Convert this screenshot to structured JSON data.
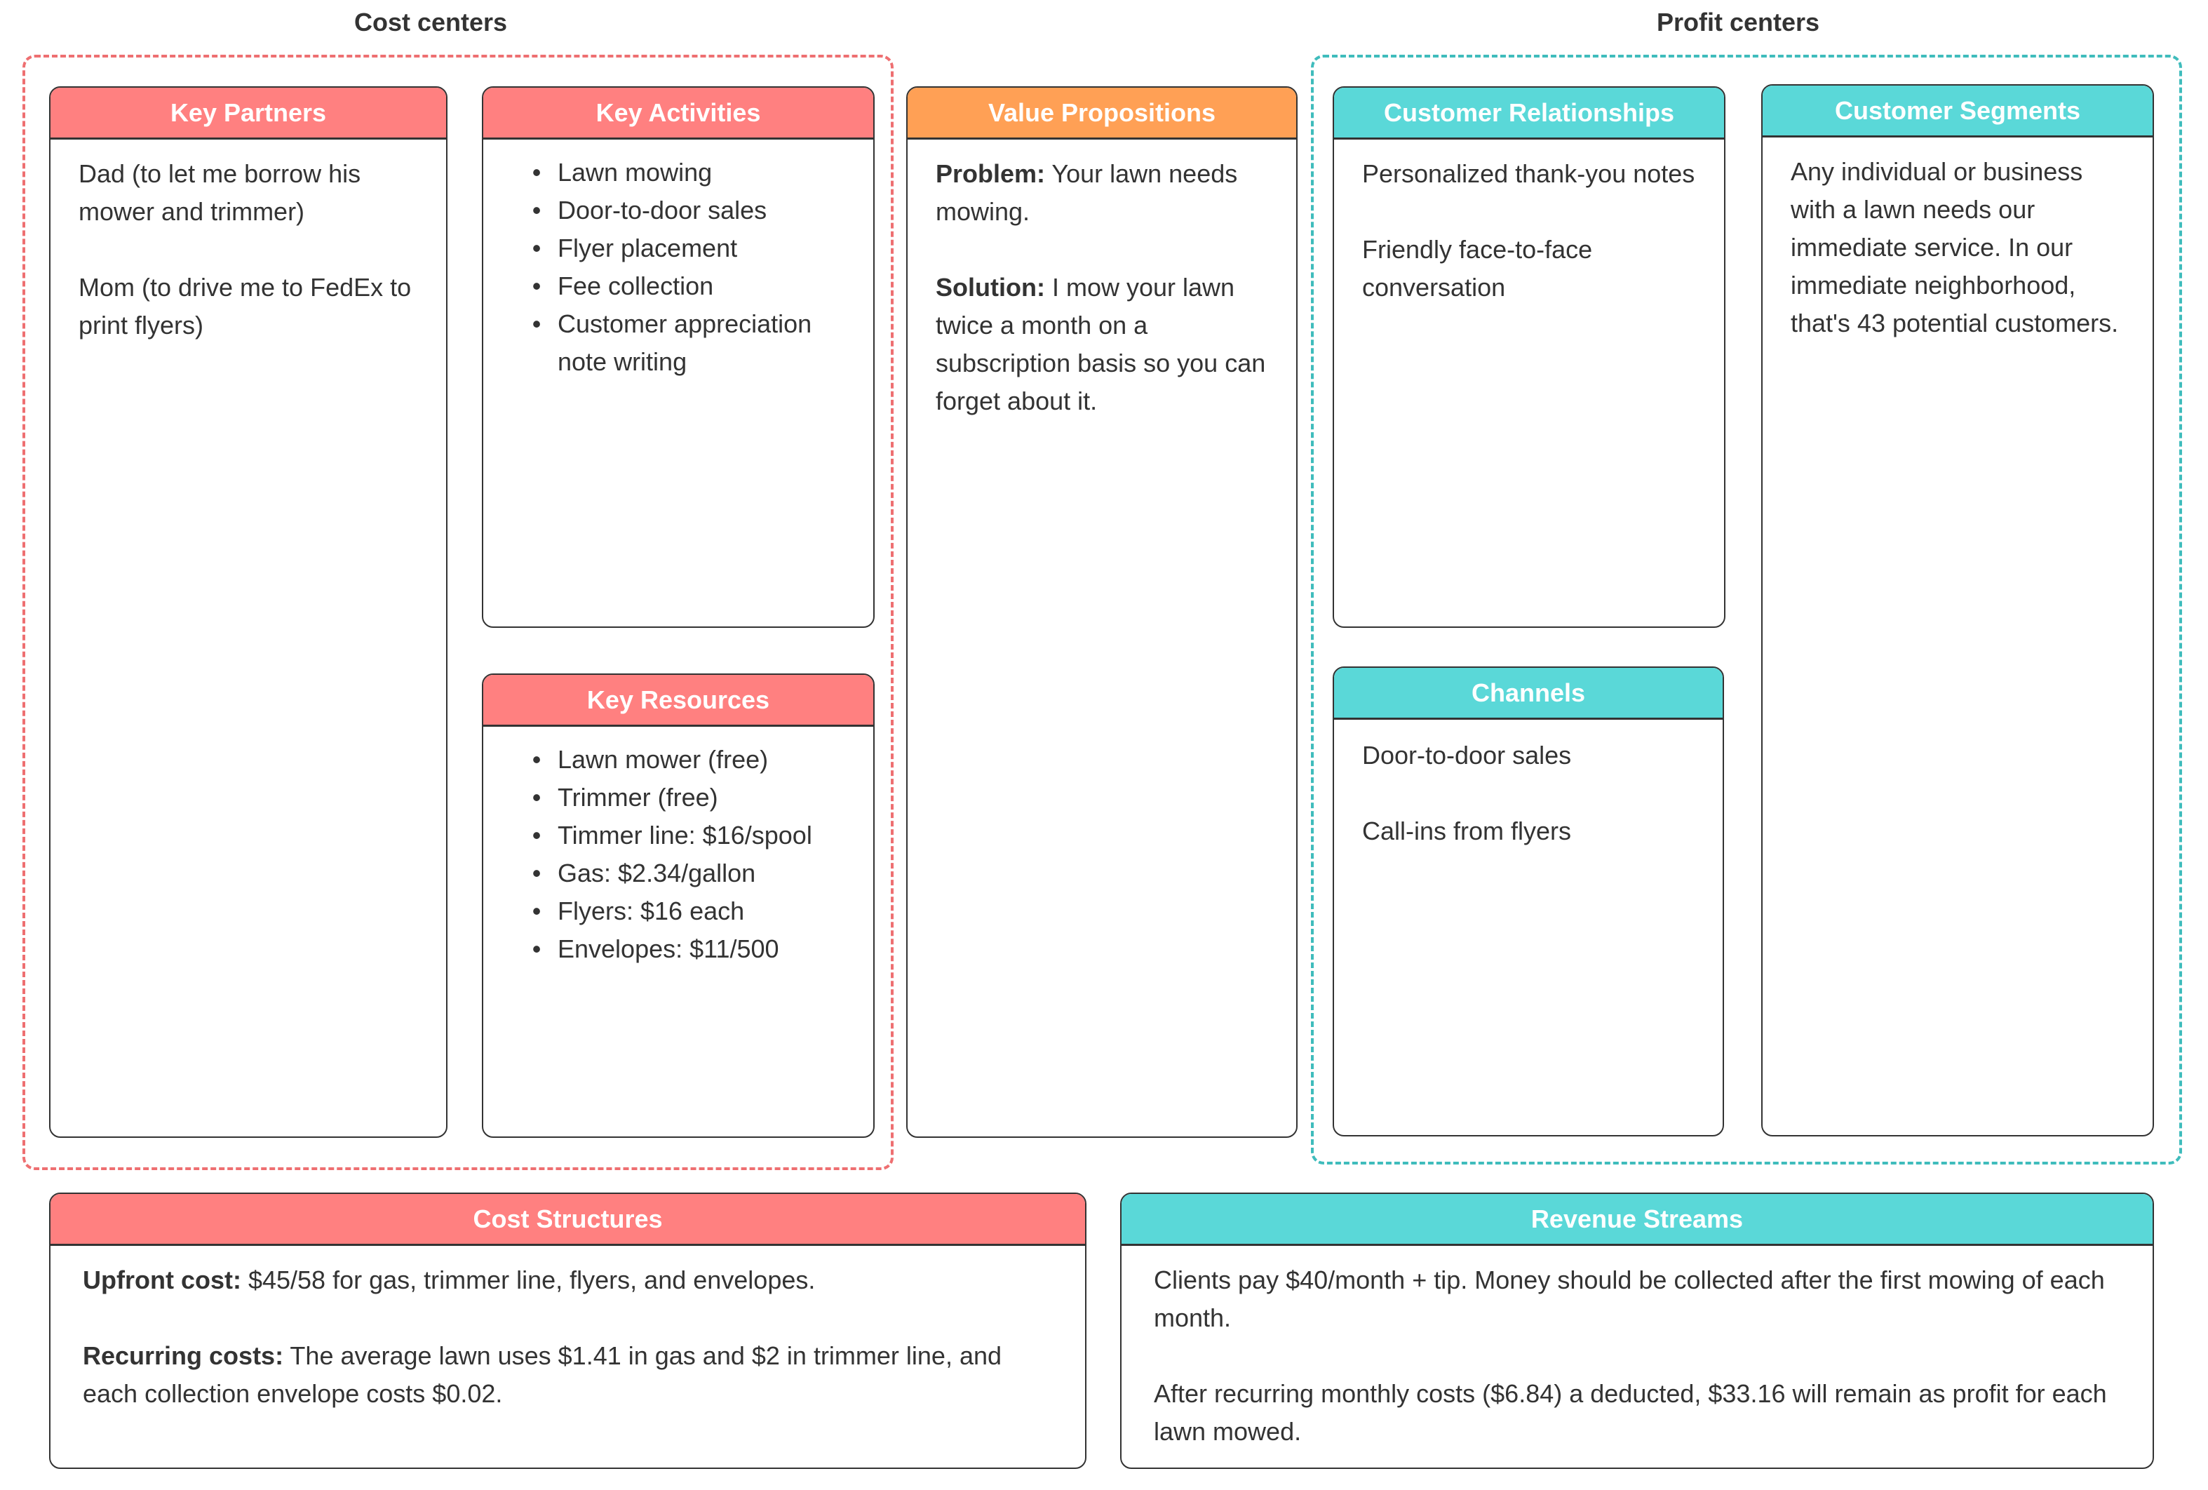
{
  "groups": {
    "cost_centers": {
      "label": "Cost centers",
      "color": "#ee6f71"
    },
    "profit_centers": {
      "label": "Profit centers",
      "color": "#3fbcbc"
    }
  },
  "colors": {
    "cost_header": "#ff8080",
    "value_header": "#ffa055",
    "profit_header": "#5ad8d8"
  },
  "key_partners": {
    "title": "Key Partners",
    "paragraphs": [
      "Dad (to let me borrow his mower and trimmer)",
      "Mom (to drive me to FedEx to print flyers)"
    ]
  },
  "key_activities": {
    "title": "Key Activities",
    "items": [
      "Lawn mowing",
      "Door-to-door sales",
      "Flyer placement",
      "Fee collection",
      "Customer appreciation note writing"
    ]
  },
  "key_resources": {
    "title": "Key Resources",
    "items": [
      "Lawn mower (free)",
      "Trimmer (free)",
      "Timmer line: $16/spool",
      "Gas: $2.34/gallon",
      "Flyers: $16 each",
      "Envelopes: $11/500"
    ]
  },
  "value_propositions": {
    "title": "Value Propositions",
    "problem_label": "Problem:",
    "problem_text": " Your lawn needs mowing.",
    "solution_label": "Solution:",
    "solution_text": " I mow your lawn twice a month on a subscription basis so you can forget about it."
  },
  "customer_relationships": {
    "title": "Customer Relationships",
    "paragraphs": [
      "Personalized thank-you notes",
      "Friendly face-to-face conversation"
    ]
  },
  "channels": {
    "title": "Channels",
    "paragraphs": [
      "Door-to-door sales",
      "Call-ins from flyers"
    ]
  },
  "customer_segments": {
    "title": "Customer Segments",
    "text": "Any individual or business with a lawn needs our immediate service. In our immediate neighborhood, that's 43 potential customers."
  },
  "cost_structures": {
    "title": "Cost Structures",
    "upfront_label": "Upfront cost:",
    "upfront_text": " $45/58 for gas, trimmer line, flyers, and envelopes.",
    "recurring_label": "Recurring costs:",
    "recurring_text": " The average lawn uses $1.41 in gas and $2 in trimmer line, and each collection envelope costs $0.02."
  },
  "revenue_streams": {
    "title": "Revenue Streams",
    "paragraphs": [
      "Clients pay $40/month + tip. Money should be collected after the first mowing of each month.",
      "After recurring monthly costs ($6.84) a deducted, $33.16 will remain as profit for each lawn mowed."
    ]
  }
}
